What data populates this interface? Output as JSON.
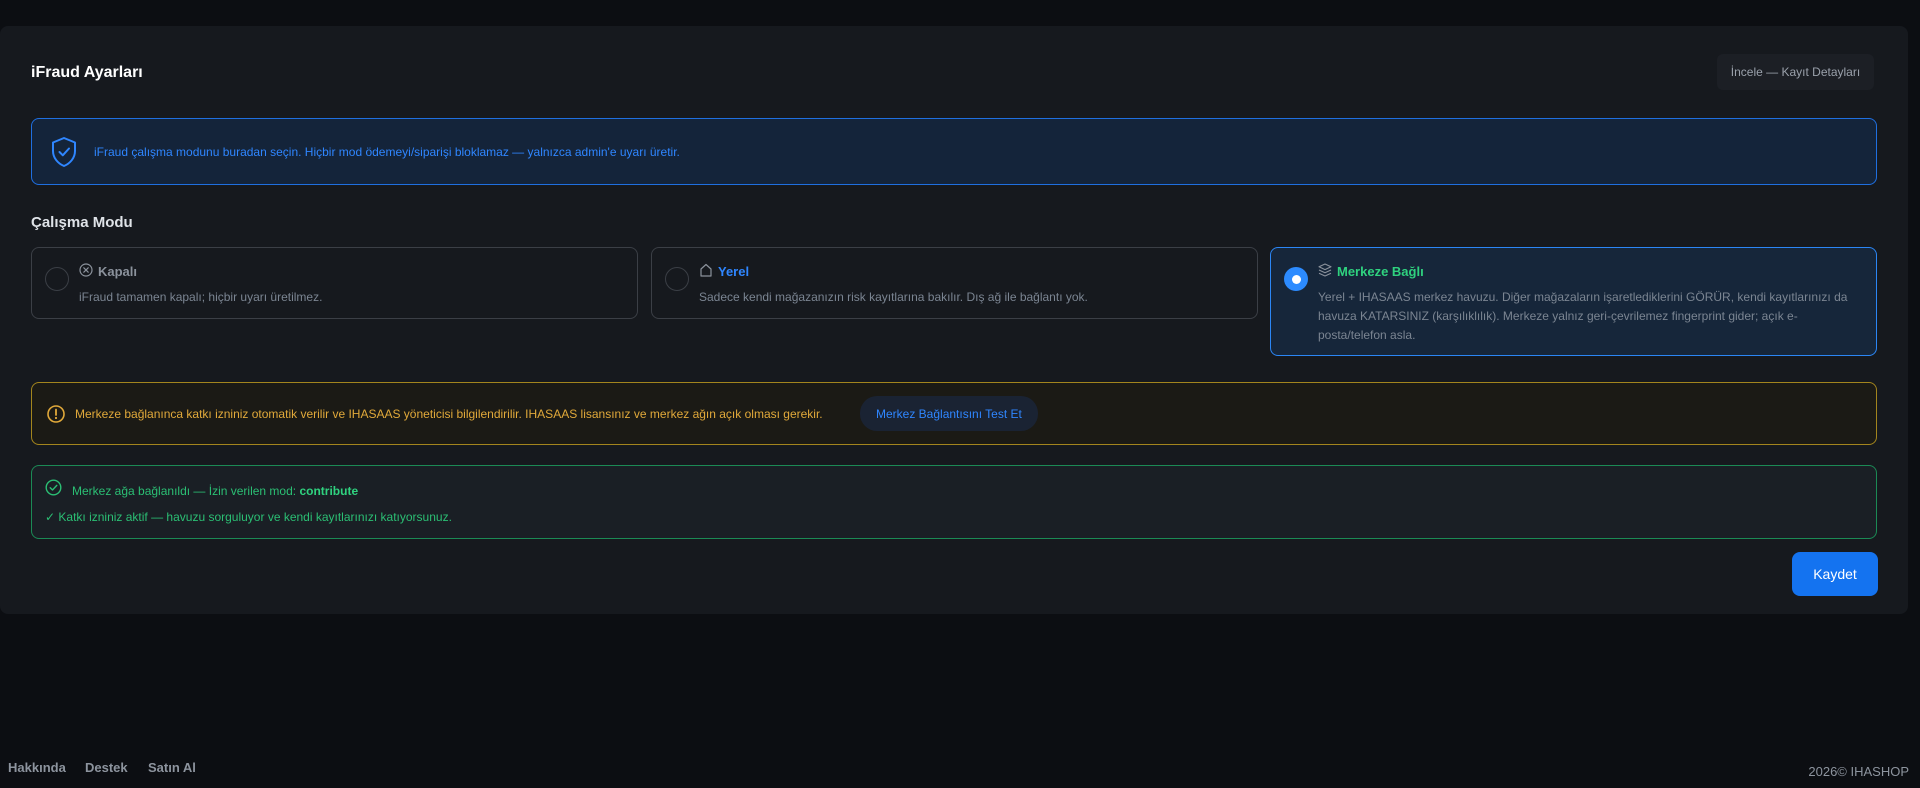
{
  "panel": {
    "title": "iFraud Ayarları",
    "inspect_label": "İncele — Kayıt Detayları"
  },
  "info": {
    "text": "iFraud çalışma modunu buradan seçin. Hiçbir mod ödemeyi/siparişi bloklamaz — yalnızca admin'e uyarı üretir."
  },
  "mode_section": {
    "title": "Çalışma Modu",
    "modes": [
      {
        "title": "Kapalı",
        "icon": "x-circle-icon",
        "description": "iFraud tamamen kapalı; hiçbir uyarı üretilmez.",
        "selected": false,
        "title_color": "#8b929c"
      },
      {
        "title": "Yerel",
        "icon": "home-icon",
        "description": "Sadece kendi mağazanızın risk kayıtlarına bakılır. Dış ağ ile bağlantı yok.",
        "selected": false,
        "title_color": "#2f86ff"
      },
      {
        "title": "Merkeze Bağlı",
        "icon": "layers-icon",
        "description": "Yerel + IHASAAS merkez havuzu. Diğer mağazaların işaretlediklerini GÖRÜR, kendi kayıtlarınızı da havuza KATARSINIZ (karşılıklılık). Merkeze yalnız geri-çevrilemez fingerprint gider; açık e-posta/telefon asla.",
        "selected": true,
        "title_color": "#2fd27f"
      }
    ]
  },
  "warning": {
    "text": "Merkeze bağlanınca katkı izniniz otomatik verilir ve IHASAAS yöneticisi bilgilendirilir. IHASAAS lisansınız ve merkez ağın açık olması gerekir.",
    "button_label": "Merkez Bağlantısını Test Et",
    "color": "#e1a93a"
  },
  "status": {
    "line1": "Merkez ağa bağlanıldı — İzin verilen mod:",
    "mode_value": "contribute",
    "line2": "✓ Katkı izniniz aktif — havuzu sorguluyor ve kendi kayıtlarınızı katıyorsunuz.",
    "color": "#2bbf74"
  },
  "save_label": "Kaydet",
  "footer": {
    "links": [
      "Hakkında",
      "Destek",
      "Satın Al"
    ],
    "copyright": "2026© IHASHOP"
  }
}
